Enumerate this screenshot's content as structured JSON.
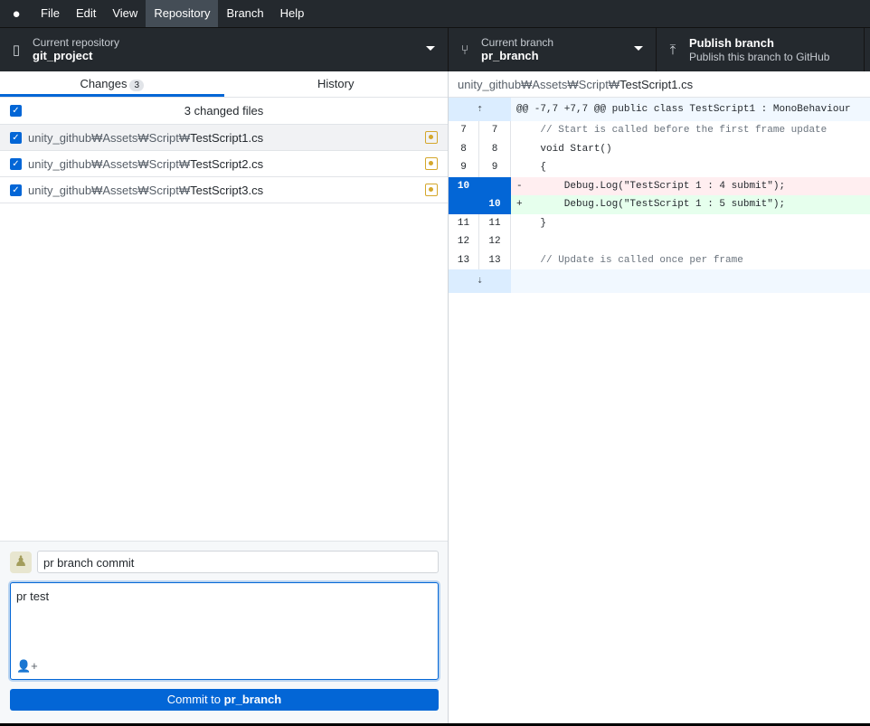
{
  "menu": {
    "items": [
      "File",
      "Edit",
      "View",
      "Repository",
      "Branch",
      "Help"
    ],
    "active": "Repository"
  },
  "toolbar": {
    "repo": {
      "label": "Current repository",
      "value": "git_project"
    },
    "branch": {
      "label": "Current branch",
      "value": "pr_branch"
    },
    "publish": {
      "title": "Publish branch",
      "subtitle": "Publish this branch to GitHub"
    }
  },
  "tabs": {
    "changes": "Changes",
    "changes_count": "3",
    "history": "History"
  },
  "changes": {
    "header": "3 changed files",
    "files": [
      {
        "dir": "unity_github₩Assets₩Script₩",
        "name": "TestScript1.cs"
      },
      {
        "dir": "unity_github₩Assets₩Script₩",
        "name": "TestScript2.cs"
      },
      {
        "dir": "unity_github₩Assets₩Script₩",
        "name": "TestScript3.cs"
      }
    ]
  },
  "commit": {
    "summary": "pr branch commit",
    "description": "pr test",
    "button_prefix": "Commit to ",
    "button_branch": "pr_branch"
  },
  "diff": {
    "path_dir": "unity_github₩Assets₩Script₩",
    "path_file": "TestScript1.cs",
    "hunk": "@@ -7,7 +7,7 @@ public class TestScript1 : MonoBehaviour",
    "lines": [
      {
        "old": "7",
        "new": "7",
        "text": "    // Start is called before the first frame update"
      },
      {
        "old": "8",
        "new": "8",
        "text": "    void Start()"
      },
      {
        "old": "9",
        "new": "9",
        "text": "    {"
      },
      {
        "old": "10",
        "new": "",
        "text": "-       Debug.Log(\"TestScript 1 : 4 submit\");"
      },
      {
        "old": "",
        "new": "10",
        "text": "+       Debug.Log(\"TestScript 1 : 5 submit\");"
      },
      {
        "old": "11",
        "new": "11",
        "text": "    }"
      },
      {
        "old": "12",
        "new": "12",
        "text": ""
      },
      {
        "old": "13",
        "new": "13",
        "text": "    // Update is called once per frame"
      }
    ]
  }
}
